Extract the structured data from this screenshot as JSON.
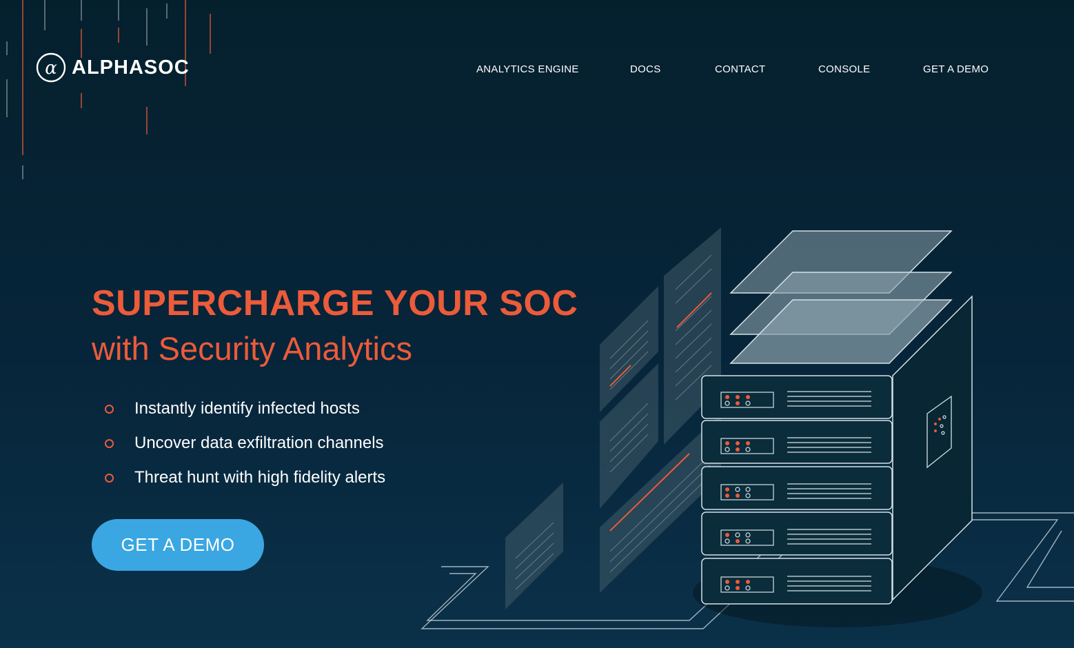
{
  "header": {
    "brand": {
      "logo_icon": "alpha-circle-icon",
      "name": "ALPHASOC"
    },
    "nav": [
      {
        "label": "ANALYTICS ENGINE"
      },
      {
        "label": "DOCS"
      },
      {
        "label": "CONTACT"
      },
      {
        "label": "CONSOLE"
      },
      {
        "label": "GET A DEMO"
      }
    ]
  },
  "hero": {
    "title": "SUPERCHARGE YOUR SOC",
    "subtitle": "with Security Analytics",
    "features": [
      {
        "icon": "circle-bullet-icon",
        "text": "Instantly identify infected hosts"
      },
      {
        "icon": "circle-bullet-icon",
        "text": "Uncover data exfiltration channels"
      },
      {
        "icon": "circle-bullet-icon",
        "text": "Threat hunt with high fidelity alerts"
      }
    ],
    "cta_label": "GET A DEMO"
  },
  "illustration": {
    "icon": "server-rack-illustration"
  },
  "colors": {
    "background": "#05202d",
    "accent": "#ec5b3a",
    "cta": "#3aa7e2",
    "text": "#ffffff"
  }
}
